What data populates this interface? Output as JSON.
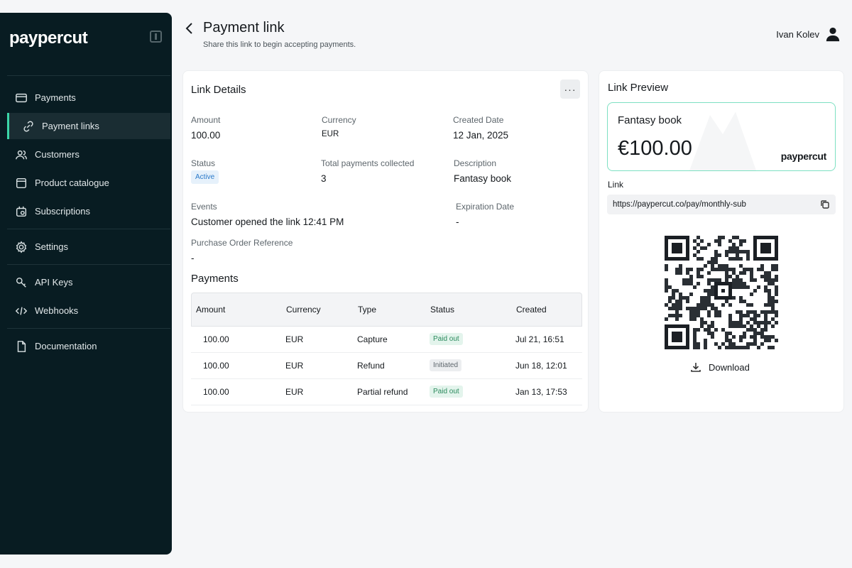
{
  "app": {
    "brand": "paypercut"
  },
  "sidebar": {
    "items": [
      {
        "label": "Payments",
        "icon": "card-icon"
      },
      {
        "label": "Payment links",
        "icon": "link-icon"
      },
      {
        "label": "Customers",
        "icon": "users-icon"
      },
      {
        "label": "Product catalogue",
        "icon": "box-icon"
      },
      {
        "label": "Subscriptions",
        "icon": "subscriptions-icon"
      },
      {
        "label": "Settings",
        "icon": "gear-icon"
      },
      {
        "label": "API Keys",
        "icon": "key-icon"
      },
      {
        "label": "Webhooks",
        "icon": "code-icon"
      },
      {
        "label": "Documentation",
        "icon": "document-icon"
      }
    ],
    "active_index": 1
  },
  "header": {
    "title": "Payment link",
    "subtitle": "Share this link to begin accepting payments.",
    "user_name": "Ivan Kolev"
  },
  "details": {
    "title": "Link Details",
    "more_label": "···",
    "fields": {
      "amount": {
        "label": "Amount",
        "value": "100.00"
      },
      "currency": {
        "label": "Currency",
        "value": "EUR"
      },
      "created": {
        "label": "Created Date",
        "value": "12 Jan, 2025"
      },
      "status": {
        "label": "Status",
        "value": "Active"
      },
      "total": {
        "label": "Total payments collected",
        "value": "3"
      },
      "description": {
        "label": "Description",
        "value": "Fantasy book"
      },
      "events": {
        "label": "Events",
        "value": "Customer opened the link 12:41 PM"
      },
      "expiration": {
        "label": "Expiration Date",
        "value": "-"
      },
      "po": {
        "label": "Purchase Order Reference",
        "value": "-"
      }
    },
    "payments": {
      "title": "Payments",
      "columns": [
        "Amount",
        "Currency",
        "Type",
        "Status",
        "Created"
      ],
      "rows": [
        {
          "amount": "100.00",
          "currency": "EUR",
          "type": "Capture",
          "status": "Paid out",
          "created": "Jul 21, 16:51"
        },
        {
          "amount": "100.00",
          "currency": "EUR",
          "type": "Refund",
          "status": "Initiated",
          "created": "Jun 18, 12:01"
        },
        {
          "amount": "100.00",
          "currency": "EUR",
          "type": "Partial refund",
          "status": "Paid out",
          "created": "Jan 13, 17:53"
        }
      ]
    }
  },
  "preview": {
    "title": "Link Preview",
    "product_name": "Fantasy book",
    "price": "€100.00",
    "brand": "paypercut",
    "link_label": "Link",
    "link_url": "https://paypercut.co/pay/monthly-sub",
    "download_label": "Download"
  },
  "colors": {
    "sidebar_bg": "#081c22",
    "accent": "#3bd6a8",
    "paid": "#2b8a5d",
    "active_badge": "#2b79c9"
  }
}
